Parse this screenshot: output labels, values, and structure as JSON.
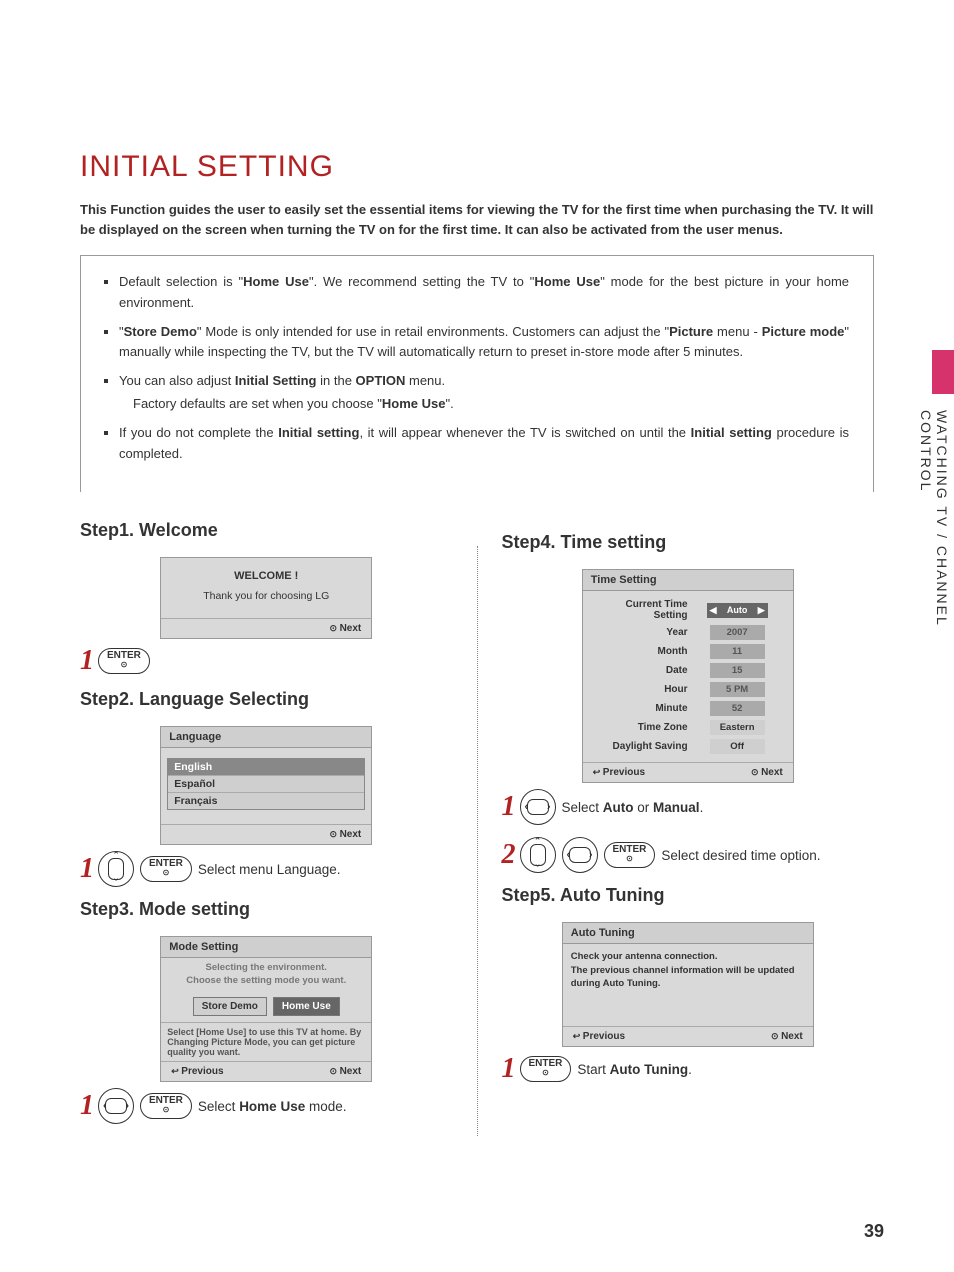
{
  "title": "INITIAL SETTING",
  "intro": "This Function guides the user to easily set the essential items for viewing the TV for the first time when purchasing the TV. It will be displayed on the screen when turning the TV on for the first time. It can also be activated from the user menus.",
  "notes": {
    "n1_a": "Default selection is \"",
    "n1_b": "Home Use",
    "n1_c": "\". We recommend setting the TV to \"",
    "n1_d": "Home Use",
    "n1_e": "\" mode for the best picture in your home environment.",
    "n2_a": "\"",
    "n2_b": "Store Demo",
    "n2_c": "\" Mode is only intended for use in retail environments. Customers can adjust the \"",
    "n2_d": "Picture",
    "n2_e": " menu - ",
    "n2_f": "Picture mode",
    "n2_g": "\" manually while inspecting the TV, but the TV will automatically return to preset in-store mode after 5 minutes.",
    "n3_a": "You can also adjust ",
    "n3_b": "Initial Setting",
    "n3_c": " in the ",
    "n3_d": "OPTION",
    "n3_e": " menu.",
    "n3_sub_a": "Factory defaults are set when you choose \"",
    "n3_sub_b": "Home Use",
    "n3_sub_c": "\".",
    "n4_a": "If you do not complete the ",
    "n4_b": "Initial setting",
    "n4_c": ", it will appear whenever the TV is switched on until the ",
    "n4_d": "Initial setting",
    "n4_e": " procedure is completed."
  },
  "steps": {
    "s1_h": "Step1. Welcome",
    "s2_h": "Step2. Language Selecting",
    "s3_h": "Step3. Mode setting",
    "s4_h": "Step4. Time setting",
    "s5_h": "Step5. Auto Tuning"
  },
  "welcome": {
    "header": "",
    "title": "WELCOME !",
    "sub": "Thank you for choosing LG",
    "next": "Next"
  },
  "language": {
    "header": "Language",
    "opts": [
      "English",
      "Español",
      "Français"
    ],
    "next": "Next",
    "action": "Select menu Language."
  },
  "mode": {
    "header": "Mode Setting",
    "title1": "Selecting the environment.",
    "title2": "Choose  the  setting mode you want.",
    "store": "Store Demo",
    "home": "Home Use",
    "note": "Select [Home Use] to use this TV at home. By Changing Picture Mode, you can get picture quality you want.",
    "prev": "Previous",
    "next": "Next",
    "action_a": "Select ",
    "action_b": "Home Use",
    "action_c": " mode."
  },
  "time": {
    "header": "Time Setting",
    "rows": [
      {
        "label": "Current Time Setting",
        "value": "Auto",
        "auto": true
      },
      {
        "label": "Year",
        "value": "2007"
      },
      {
        "label": "Month",
        "value": "11"
      },
      {
        "label": "Date",
        "value": "15"
      },
      {
        "label": "Hour",
        "value": "5 PM"
      },
      {
        "label": "Minute",
        "value": "52"
      },
      {
        "label": "Time Zone",
        "value": "Eastern",
        "lt": true
      },
      {
        "label": "Daylight Saving",
        "value": "Off",
        "lt": true
      }
    ],
    "prev": "Previous",
    "next": "Next",
    "act1_a": "Select ",
    "act1_b": "Auto",
    "act1_c": " or ",
    "act1_d": "Manual",
    "act1_e": ".",
    "act2": "Select desired time option."
  },
  "autotune": {
    "header": "Auto Tuning",
    "body1": "Check your antenna connection.",
    "body2": "The previous channel information will be updated during Auto Tuning.",
    "prev": "Previous",
    "next": "Next",
    "action_a": "Start ",
    "action_b": "Auto Tuning",
    "action_c": "."
  },
  "enter": "ENTER",
  "side": "WATCHING TV / CHANNEL CONTROL",
  "pagenum": "39"
}
